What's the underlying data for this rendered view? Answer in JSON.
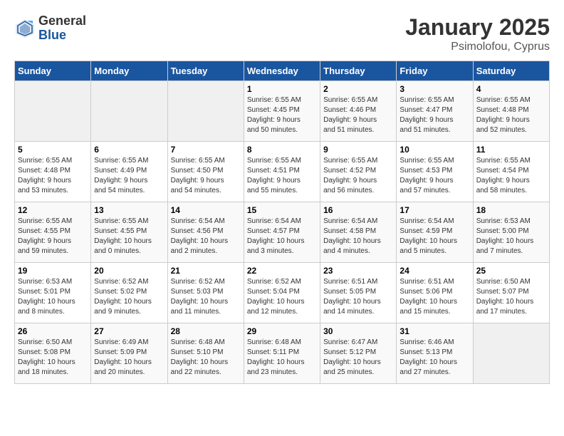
{
  "header": {
    "logo": {
      "general": "General",
      "blue": "Blue"
    },
    "title": "January 2025",
    "location": "Psimolofou, Cyprus"
  },
  "weekdays": [
    "Sunday",
    "Monday",
    "Tuesday",
    "Wednesday",
    "Thursday",
    "Friday",
    "Saturday"
  ],
  "weeks": [
    [
      {
        "day": null,
        "info": null
      },
      {
        "day": null,
        "info": null
      },
      {
        "day": null,
        "info": null
      },
      {
        "day": "1",
        "info": "Sunrise: 6:55 AM\nSunset: 4:45 PM\nDaylight: 9 hours\nand 50 minutes."
      },
      {
        "day": "2",
        "info": "Sunrise: 6:55 AM\nSunset: 4:46 PM\nDaylight: 9 hours\nand 51 minutes."
      },
      {
        "day": "3",
        "info": "Sunrise: 6:55 AM\nSunset: 4:47 PM\nDaylight: 9 hours\nand 51 minutes."
      },
      {
        "day": "4",
        "info": "Sunrise: 6:55 AM\nSunset: 4:48 PM\nDaylight: 9 hours\nand 52 minutes."
      }
    ],
    [
      {
        "day": "5",
        "info": "Sunrise: 6:55 AM\nSunset: 4:48 PM\nDaylight: 9 hours\nand 53 minutes."
      },
      {
        "day": "6",
        "info": "Sunrise: 6:55 AM\nSunset: 4:49 PM\nDaylight: 9 hours\nand 54 minutes."
      },
      {
        "day": "7",
        "info": "Sunrise: 6:55 AM\nSunset: 4:50 PM\nDaylight: 9 hours\nand 54 minutes."
      },
      {
        "day": "8",
        "info": "Sunrise: 6:55 AM\nSunset: 4:51 PM\nDaylight: 9 hours\nand 55 minutes."
      },
      {
        "day": "9",
        "info": "Sunrise: 6:55 AM\nSunset: 4:52 PM\nDaylight: 9 hours\nand 56 minutes."
      },
      {
        "day": "10",
        "info": "Sunrise: 6:55 AM\nSunset: 4:53 PM\nDaylight: 9 hours\nand 57 minutes."
      },
      {
        "day": "11",
        "info": "Sunrise: 6:55 AM\nSunset: 4:54 PM\nDaylight: 9 hours\nand 58 minutes."
      }
    ],
    [
      {
        "day": "12",
        "info": "Sunrise: 6:55 AM\nSunset: 4:55 PM\nDaylight: 9 hours\nand 59 minutes."
      },
      {
        "day": "13",
        "info": "Sunrise: 6:55 AM\nSunset: 4:55 PM\nDaylight: 10 hours\nand 0 minutes."
      },
      {
        "day": "14",
        "info": "Sunrise: 6:54 AM\nSunset: 4:56 PM\nDaylight: 10 hours\nand 2 minutes."
      },
      {
        "day": "15",
        "info": "Sunrise: 6:54 AM\nSunset: 4:57 PM\nDaylight: 10 hours\nand 3 minutes."
      },
      {
        "day": "16",
        "info": "Sunrise: 6:54 AM\nSunset: 4:58 PM\nDaylight: 10 hours\nand 4 minutes."
      },
      {
        "day": "17",
        "info": "Sunrise: 6:54 AM\nSunset: 4:59 PM\nDaylight: 10 hours\nand 5 minutes."
      },
      {
        "day": "18",
        "info": "Sunrise: 6:53 AM\nSunset: 5:00 PM\nDaylight: 10 hours\nand 7 minutes."
      }
    ],
    [
      {
        "day": "19",
        "info": "Sunrise: 6:53 AM\nSunset: 5:01 PM\nDaylight: 10 hours\nand 8 minutes."
      },
      {
        "day": "20",
        "info": "Sunrise: 6:52 AM\nSunset: 5:02 PM\nDaylight: 10 hours\nand 9 minutes."
      },
      {
        "day": "21",
        "info": "Sunrise: 6:52 AM\nSunset: 5:03 PM\nDaylight: 10 hours\nand 11 minutes."
      },
      {
        "day": "22",
        "info": "Sunrise: 6:52 AM\nSunset: 5:04 PM\nDaylight: 10 hours\nand 12 minutes."
      },
      {
        "day": "23",
        "info": "Sunrise: 6:51 AM\nSunset: 5:05 PM\nDaylight: 10 hours\nand 14 minutes."
      },
      {
        "day": "24",
        "info": "Sunrise: 6:51 AM\nSunset: 5:06 PM\nDaylight: 10 hours\nand 15 minutes."
      },
      {
        "day": "25",
        "info": "Sunrise: 6:50 AM\nSunset: 5:07 PM\nDaylight: 10 hours\nand 17 minutes."
      }
    ],
    [
      {
        "day": "26",
        "info": "Sunrise: 6:50 AM\nSunset: 5:08 PM\nDaylight: 10 hours\nand 18 minutes."
      },
      {
        "day": "27",
        "info": "Sunrise: 6:49 AM\nSunset: 5:09 PM\nDaylight: 10 hours\nand 20 minutes."
      },
      {
        "day": "28",
        "info": "Sunrise: 6:48 AM\nSunset: 5:10 PM\nDaylight: 10 hours\nand 22 minutes."
      },
      {
        "day": "29",
        "info": "Sunrise: 6:48 AM\nSunset: 5:11 PM\nDaylight: 10 hours\nand 23 minutes."
      },
      {
        "day": "30",
        "info": "Sunrise: 6:47 AM\nSunset: 5:12 PM\nDaylight: 10 hours\nand 25 minutes."
      },
      {
        "day": "31",
        "info": "Sunrise: 6:46 AM\nSunset: 5:13 PM\nDaylight: 10 hours\nand 27 minutes."
      },
      {
        "day": null,
        "info": null
      }
    ]
  ]
}
